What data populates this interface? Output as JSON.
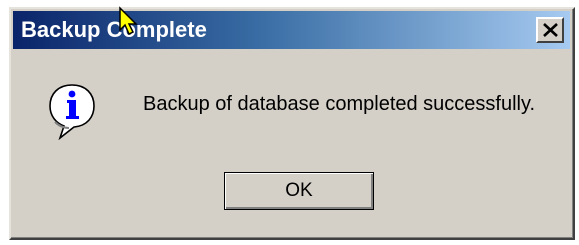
{
  "dialog": {
    "title": "Backup Complete",
    "message": "Backup of database completed successfully.",
    "ok_label": "OK",
    "icon": "info-icon",
    "close_icon": "close-icon"
  },
  "colors": {
    "titlebar_start": "#0a246a",
    "titlebar_end": "#a6caf0",
    "face": "#d4d0c8"
  }
}
